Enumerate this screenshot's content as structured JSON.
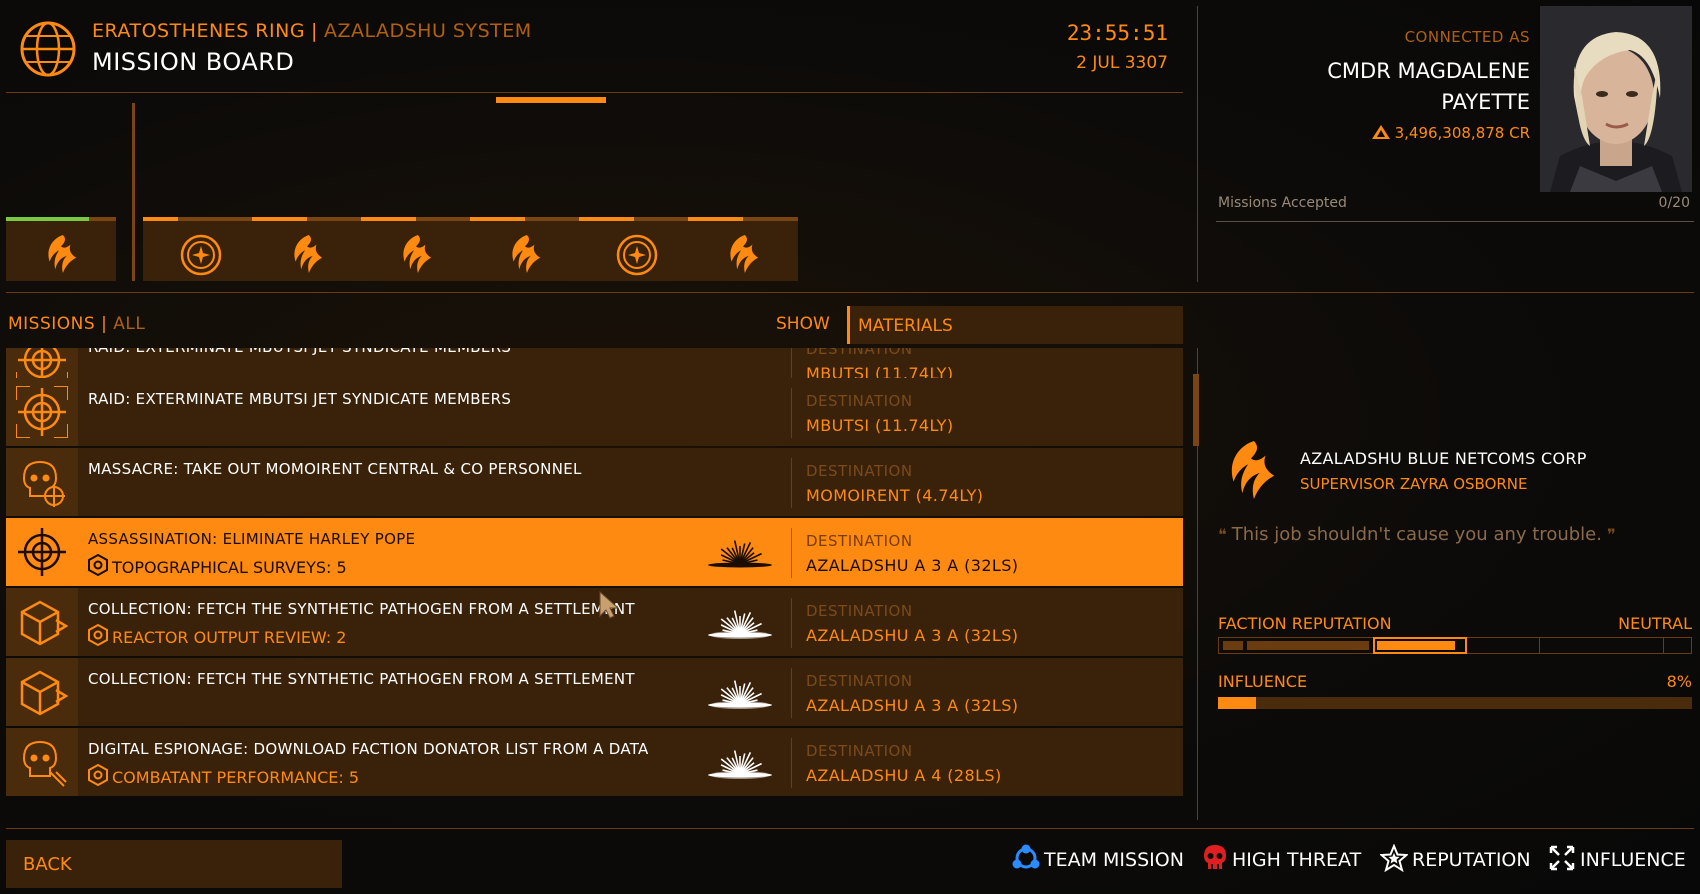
{
  "header": {
    "station": "ERATOSTHENES RING",
    "separator": "|",
    "system": "AZALADSHU SYSTEM",
    "title": "MISSION BOARD",
    "time": "23:55:51",
    "date": "2 JUL 3307"
  },
  "commander": {
    "connected_label": "CONNECTED AS",
    "name_line1": "CMDR MAGDALENE",
    "name_line2": "PAYETTE",
    "credits": "3,496,308,878 CR",
    "missions_label": "Missions Accepted",
    "missions_count": "0/20"
  },
  "faction_tabs": [
    {
      "icon": "phoenix-icon",
      "progress": 0.75,
      "color": "#7ac943"
    },
    {
      "icon": "federation-icon",
      "progress": 0.32,
      "color": "#ff8a12"
    },
    {
      "icon": "phoenix-icon",
      "progress": 0.5,
      "color": "#ff8a12"
    },
    {
      "icon": "phoenix-icon",
      "progress": 0.5,
      "color": "#ff8a12"
    },
    {
      "icon": "phoenix-icon",
      "progress": 0.5,
      "color": "#ff8a12"
    },
    {
      "icon": "federation-icon",
      "progress": 0.5,
      "color": "#ff8a12"
    },
    {
      "icon": "phoenix-icon",
      "progress": 0.5,
      "color": "#ff8a12"
    }
  ],
  "missions_header": {
    "label": "MISSIONS",
    "separator": "|",
    "filter": "ALL",
    "show_label": "SHOW",
    "show_value": "MATERIALS"
  },
  "missions": [
    {
      "title": "RAID: EXTERMINATE MBUTSI JET SYNDICATE MEMBERS",
      "reward": "",
      "dest_label": "DESTINATION",
      "dest": "MBUTSI (11.74LY)",
      "icon": "target-icon"
    },
    {
      "title": "RAID: EXTERMINATE MBUTSI JET SYNDICATE MEMBERS",
      "reward": "",
      "dest_label": "DESTINATION",
      "dest": "MBUTSI (11.74LY)",
      "icon": "target-icon"
    },
    {
      "title": "MASSACRE: TAKE OUT MOMOIRENT CENTRAL & CO PERSONNEL",
      "reward": "",
      "dest_label": "DESTINATION",
      "dest": "MOMOIRENT (4.74LY)",
      "icon": "skull-target-icon"
    },
    {
      "title": "ASSASSINATION: ELIMINATE HARLEY POPE",
      "reward": "TOPOGRAPHICAL SURVEYS: 5",
      "dest_label": "DESTINATION",
      "dest": "AZALADSHU A 3 A (32LS)",
      "icon": "target-icon"
    },
    {
      "title": "COLLECTION: FETCH THE SYNTHETIC PATHOGEN FROM A SETTLEMENT",
      "reward": "REACTOR OUTPUT REVIEW: 2",
      "dest_label": "DESTINATION",
      "dest": "AZALADSHU A 3 A (32LS)",
      "icon": "cargo-box-icon"
    },
    {
      "title": "COLLECTION: FETCH THE SYNTHETIC PATHOGEN FROM A SETTLEMENT",
      "reward": "",
      "dest_label": "DESTINATION",
      "dest": "AZALADSHU A 3 A (32LS)",
      "icon": "cargo-box-icon"
    },
    {
      "title": "DIGITAL ESPIONAGE: DOWNLOAD FACTION DONATOR LIST FROM A DATA",
      "reward": "COMBATANT PERFORMANCE: 5",
      "dest_label": "DESTINATION",
      "dest": "AZALADSHU A 4 (28LS)",
      "icon": "skull-data-icon"
    }
  ],
  "faction_detail": {
    "name": "AZALADSHU BLUE NETCOMS CORP",
    "supervisor": "SUPERVISOR ZAYRA OSBORNE",
    "quote": "This job shouldn't cause you any trouble.",
    "reputation_label": "FACTION REPUTATION",
    "reputation_value": "NEUTRAL",
    "influence_label": "INFLUENCE",
    "influence_value": "8%",
    "influence_fraction": 0.08
  },
  "footer": {
    "back": "BACK",
    "legend": [
      {
        "label": "TEAM MISSION",
        "icon": "team-icon",
        "color": "#2a8cff"
      },
      {
        "label": "HIGH THREAT",
        "icon": "skull-icon",
        "color": "#e02020"
      },
      {
        "label": "REPUTATION",
        "icon": "star-icon",
        "color": "#ffffff"
      },
      {
        "label": "INFLUENCE",
        "icon": "arrows-icon",
        "color": "#ffffff"
      }
    ]
  }
}
